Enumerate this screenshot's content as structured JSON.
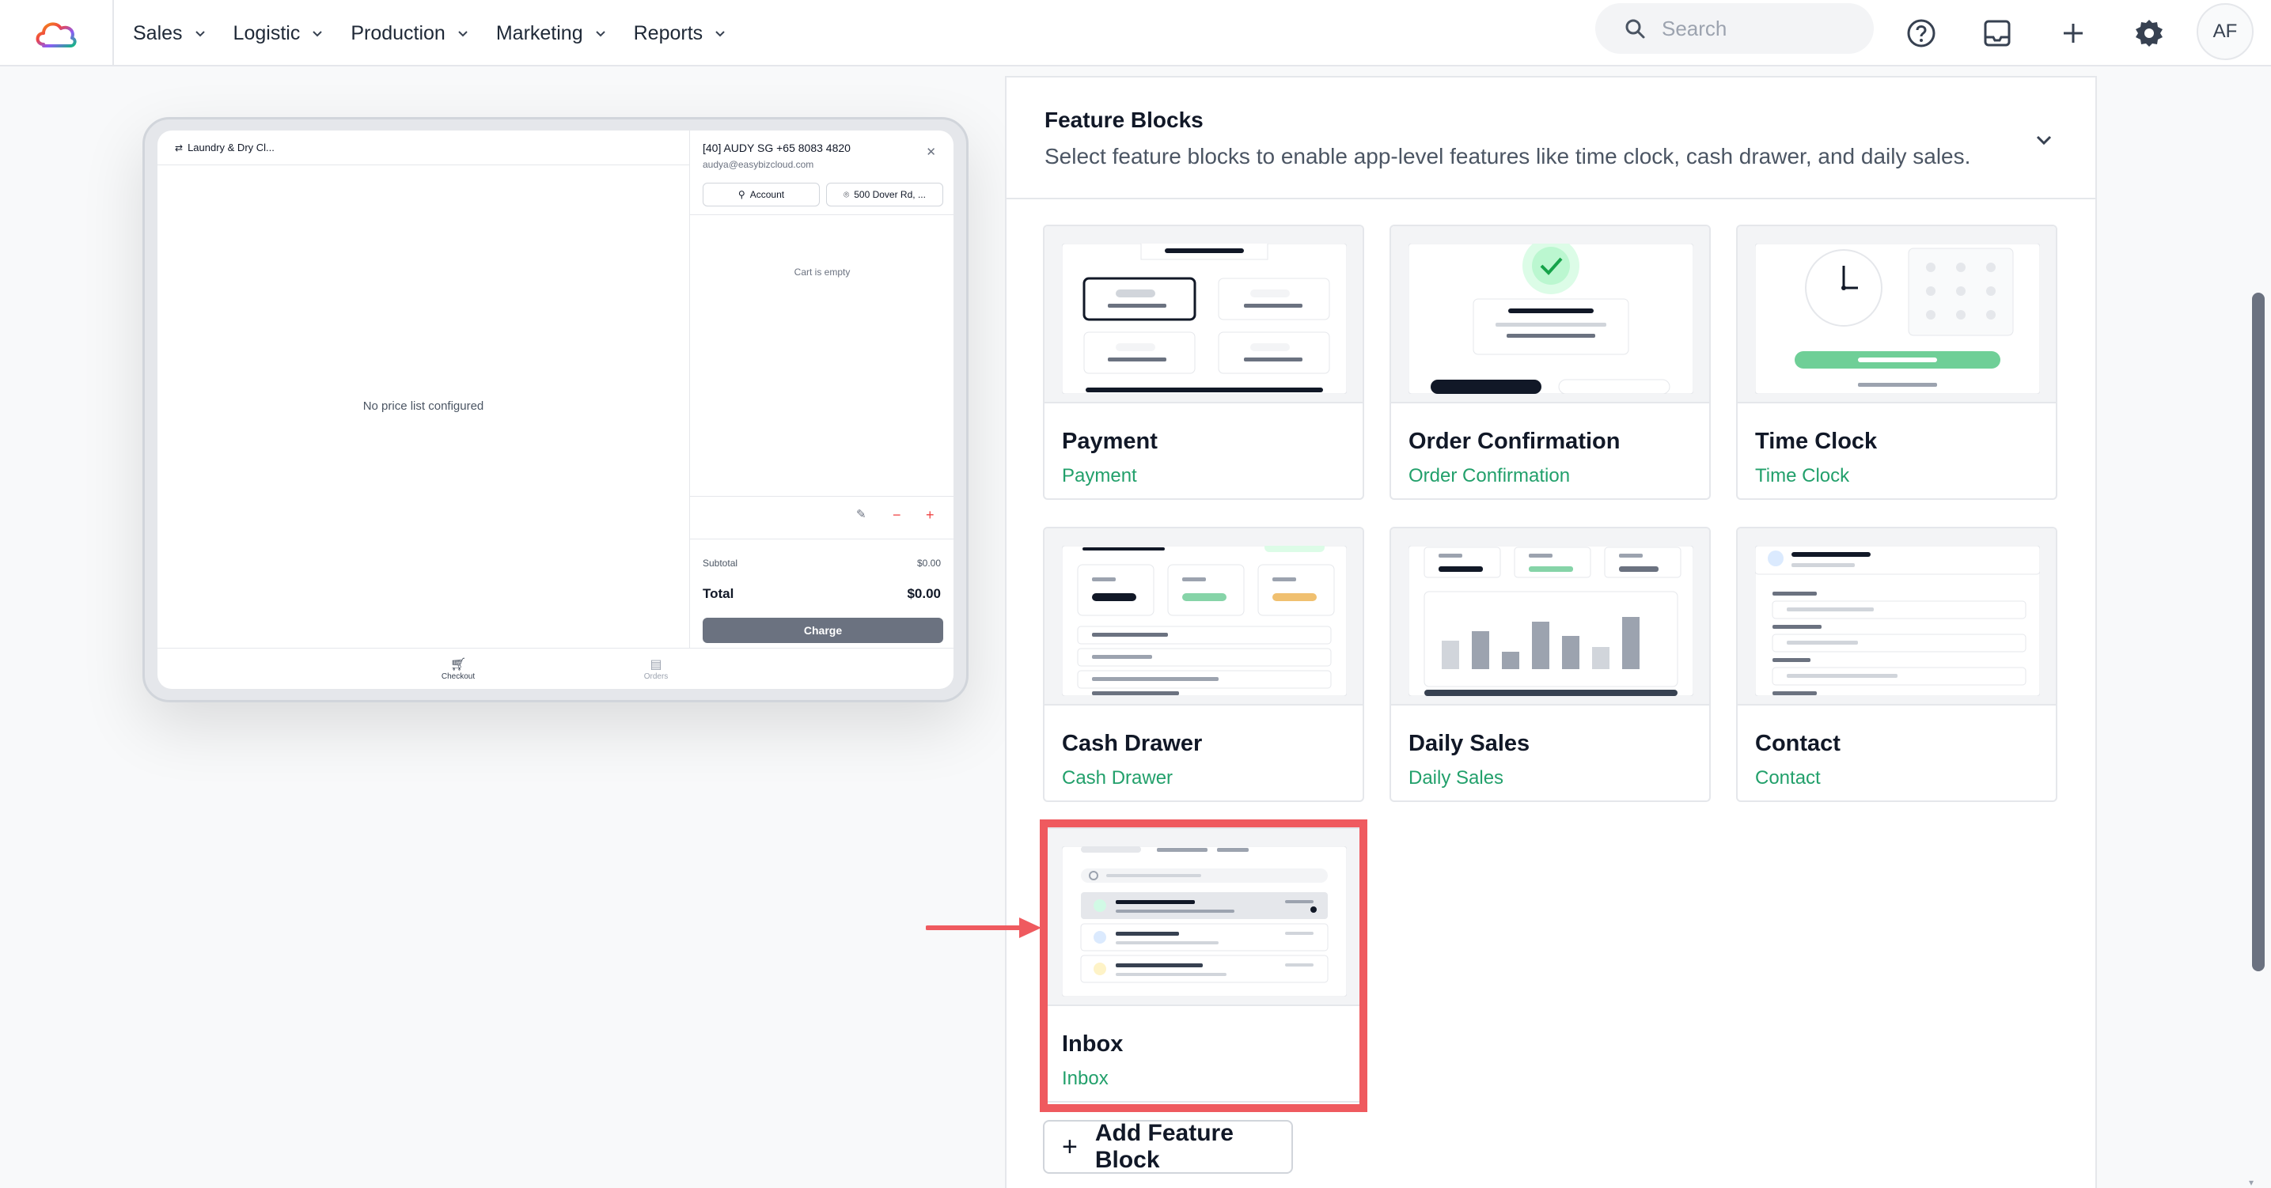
{
  "topbar": {
    "nav": [
      {
        "label": "Sales"
      },
      {
        "label": "Logistic"
      },
      {
        "label": "Production"
      },
      {
        "label": "Marketing"
      },
      {
        "label": "Reports"
      }
    ],
    "search_placeholder": "Search",
    "avatar_initials": "AF",
    "icons": [
      "help-icon",
      "inbox-icon",
      "plus-icon",
      "gear-icon"
    ]
  },
  "preview": {
    "store_name": "Laundry & Dry Cl...",
    "empty_price_list": "No price list configured",
    "customer_name": "[40] AUDY SG +65 8083 4820",
    "customer_email": "audya@easybizcloud.com",
    "account_label": "Account",
    "address_label": "500 Dover Rd, ...",
    "cart_empty": "Cart is empty",
    "subtotal_label": "Subtotal",
    "subtotal_value": "$0.00",
    "total_label": "Total",
    "total_value": "$0.00",
    "charge_label": "Charge",
    "tabs": [
      {
        "label": "Checkout"
      },
      {
        "label": "Orders"
      }
    ]
  },
  "feature_blocks": {
    "title": "Feature Blocks",
    "subtitle": "Select feature blocks to enable app-level features like time clock, cash drawer, and daily sales.",
    "cards": [
      {
        "title": "Payment",
        "subtitle": "Payment"
      },
      {
        "title": "Order Confirmation",
        "subtitle": "Order Confirmation"
      },
      {
        "title": "Time Clock",
        "subtitle": "Time Clock"
      },
      {
        "title": "Cash Drawer",
        "subtitle": "Cash Drawer"
      },
      {
        "title": "Daily Sales",
        "subtitle": "Daily Sales"
      },
      {
        "title": "Contact",
        "subtitle": "Contact"
      },
      {
        "title": "Inbox",
        "subtitle": "Inbox"
      }
    ],
    "add_label": "Add Feature Block"
  },
  "colors": {
    "accent_green": "#22a06b",
    "highlight_red": "#ef5a5f"
  }
}
